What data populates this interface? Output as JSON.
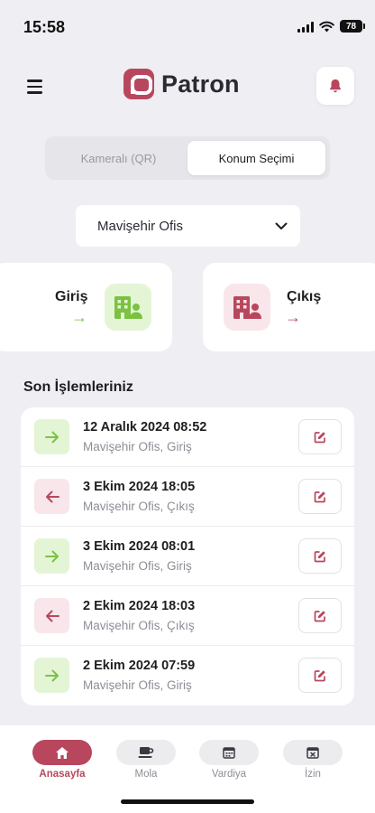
{
  "status_bar": {
    "time": "15:58",
    "battery": "78"
  },
  "header": {
    "brand": "Patron"
  },
  "mode_tabs": [
    {
      "label": "Kameralı (QR)",
      "active": false
    },
    {
      "label": "Konum Seçimi",
      "active": true
    }
  ],
  "location": {
    "selected": "Mavişehir Ofis"
  },
  "actions": {
    "check_in": {
      "label": "Giriş",
      "arrow": "→"
    },
    "check_out": {
      "label": "Çıkış",
      "arrow": "→"
    }
  },
  "recent": {
    "title": "Son İşlemleriniz",
    "items": [
      {
        "direction": "in",
        "datetime": "12 Aralık 2024 08:52",
        "detail": "Mavişehir Ofis, Giriş"
      },
      {
        "direction": "out",
        "datetime": "3 Ekim 2024 18:05",
        "detail": "Mavişehir Ofis, Çıkış"
      },
      {
        "direction": "in",
        "datetime": "3 Ekim 2024 08:01",
        "detail": "Mavişehir Ofis, Giriş"
      },
      {
        "direction": "out",
        "datetime": "2 Ekim 2024 18:03",
        "detail": "Mavişehir Ofis, Çıkış"
      },
      {
        "direction": "in",
        "datetime": "2 Ekim 2024 07:59",
        "detail": "Mavişehir Ofis, Giriş"
      }
    ]
  },
  "bottom_nav": [
    {
      "label": "Anasayfa",
      "icon": "home-icon",
      "active": true
    },
    {
      "label": "Mola",
      "icon": "coffee-icon",
      "active": false
    },
    {
      "label": "Vardiya",
      "icon": "calendar-icon",
      "active": false
    },
    {
      "label": "İzin",
      "icon": "calendar-x-icon",
      "active": false
    }
  ],
  "colors": {
    "brand": "#b8475e",
    "check_in_green": "#7bc242",
    "check_in_bg": "#e4f5d6",
    "check_out_bg": "#f8e6ea",
    "background": "#efeef2"
  }
}
